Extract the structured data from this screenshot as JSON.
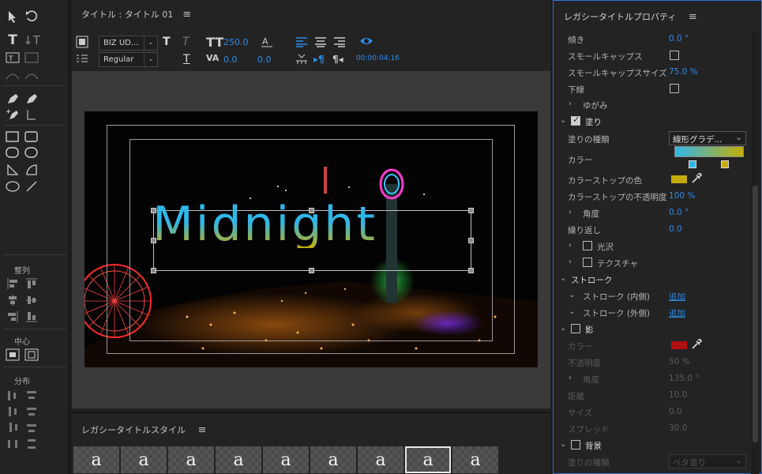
{
  "title_panel": {
    "title": "タイトル : タイトル 01",
    "font_family": "BIZ UD...",
    "font_style": "Regular",
    "font_size": "250.0",
    "leading": "0.0",
    "kerning": "0.0",
    "timecode": "00:00:04:16",
    "title_text": "Midnight"
  },
  "tools": {
    "align_label": "整列",
    "center_label": "中心",
    "distribute_label": "分布"
  },
  "styles_panel": {
    "title": "レガシータイトルスタイル",
    "swatch_glyph": "a",
    "swatch_count": 9
  },
  "props": {
    "title": "レガシータイトルプロパティ",
    "rows": {
      "slant": {
        "label": "傾き",
        "value": "0.0 °"
      },
      "small_caps": {
        "label": "スモールキャップス"
      },
      "small_caps_size": {
        "label": "スモールキャップスサイズ",
        "value": "75.0 %"
      },
      "underline": {
        "label": "下線"
      },
      "distort": {
        "label": "ゆがみ"
      },
      "fill": {
        "label": "塗り"
      },
      "fill_type": {
        "label": "塗りの種類",
        "value": "線形グラデ..."
      },
      "color": {
        "label": "カラー"
      },
      "stop_color": {
        "label": "カラーストップの色"
      },
      "stop_opacity": {
        "label": "カラーストップの不透明度",
        "value": "100 %"
      },
      "angle": {
        "label": "角度",
        "value": "0.0 °"
      },
      "repeat": {
        "label": "繰り返し",
        "value": "0.0"
      },
      "sheen": {
        "label": "光沢"
      },
      "texture": {
        "label": "テクスチャ"
      },
      "stroke": {
        "label": "ストローク"
      },
      "inner_stroke": {
        "label": "ストローク (内側)",
        "value": "追加"
      },
      "outer_stroke": {
        "label": "ストローク (外側)",
        "value": "追加"
      },
      "shadow": {
        "label": "影"
      },
      "shadow_color": {
        "label": "カラー"
      },
      "shadow_opacity": {
        "label": "不透明度",
        "value": "50 %"
      },
      "shadow_angle": {
        "label": "角度",
        "value": "135.0 °"
      },
      "shadow_distance": {
        "label": "距離",
        "value": "10.0"
      },
      "shadow_size": {
        "label": "サイズ",
        "value": "0.0"
      },
      "shadow_spread": {
        "label": "スプレッド",
        "value": "30.0"
      },
      "background": {
        "label": "背景"
      },
      "bg_fill_type": {
        "label": "塗りの種類",
        "value": "ベタ塗り"
      }
    },
    "colors": {
      "gradient_start": "#2fb7e8",
      "gradient_end": "#c4ad0a",
      "stop_color": "#c4ad0a",
      "shadow_color": "#b01010",
      "accent": "#2d8ceb"
    }
  }
}
